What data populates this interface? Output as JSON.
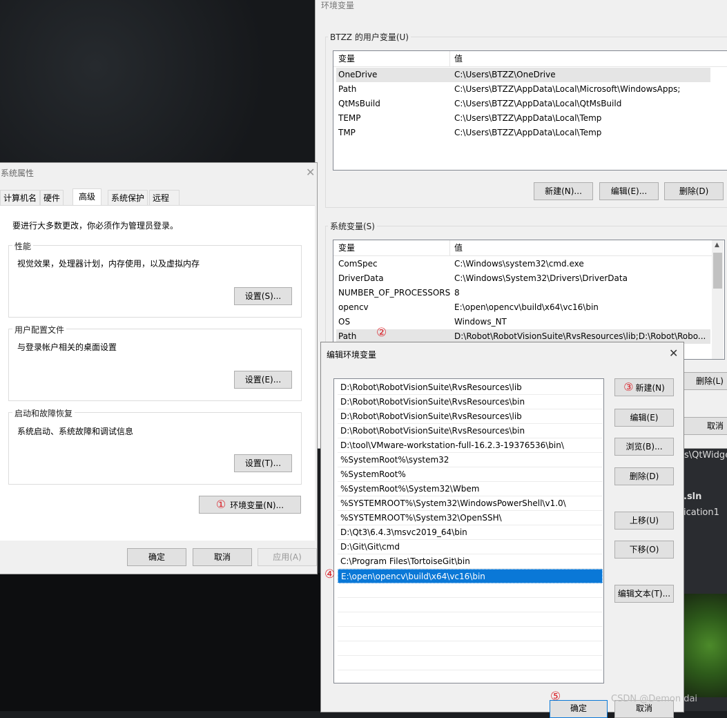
{
  "env_window": {
    "title": "环境变量",
    "user_group_label": "BTZZ 的用户变量(U)",
    "user_header": [
      "变量",
      "值"
    ],
    "user_rows": [
      {
        "name": "OneDrive",
        "value": "C:\\Users\\BTZZ\\OneDrive"
      },
      {
        "name": "Path",
        "value": "C:\\Users\\BTZZ\\AppData\\Local\\Microsoft\\WindowsApps;"
      },
      {
        "name": "QtMsBuild",
        "value": "C:\\Users\\BTZZ\\AppData\\Local\\QtMsBuild"
      },
      {
        "name": "TEMP",
        "value": "C:\\Users\\BTZZ\\AppData\\Local\\Temp"
      },
      {
        "name": "TMP",
        "value": "C:\\Users\\BTZZ\\AppData\\Local\\Temp"
      }
    ],
    "user_buttons": {
      "new": "新建(N)...",
      "edit": "编辑(E)...",
      "delete": "删除(D)"
    },
    "sys_group_label": "系统变量(S)",
    "sys_header": [
      "变量",
      "值"
    ],
    "sys_rows": [
      {
        "name": "ComSpec",
        "value": "C:\\Windows\\system32\\cmd.exe"
      },
      {
        "name": "DriverData",
        "value": "C:\\Windows\\System32\\Drivers\\DriverData"
      },
      {
        "name": "NUMBER_OF_PROCESSORS",
        "value": "8"
      },
      {
        "name": "opencv",
        "value": "E:\\open\\opencv\\build\\x64\\vc16\\bin"
      },
      {
        "name": "OS",
        "value": "Windows_NT"
      },
      {
        "name": "Path",
        "value": "D:\\Robot\\RobotVisionSuite\\RvsResources\\lib;D:\\Robot\\Robo..."
      }
    ],
    "sys_delete_partial": "删除(L)",
    "cancel_partial": "取消"
  },
  "sys_props": {
    "title": "系统属性",
    "tabs": [
      "计算机名",
      "硬件",
      "高级",
      "系统保护",
      "远程"
    ],
    "admin_note": "要进行大多数更改，你必须作为管理员登录。",
    "perf_label": "性能",
    "perf_desc": "视觉效果，处理器计划，内存使用，以及虚拟内存",
    "perf_btn": "设置(S)...",
    "profile_label": "用户配置文件",
    "profile_desc": "与登录帐户相关的桌面设置",
    "profile_btn": "设置(E)...",
    "startup_label": "启动和故障恢复",
    "startup_desc": "系统启动、系统故障和调试信息",
    "startup_btn": "设置(T)...",
    "env_btn": "环境变量(N)...",
    "ok": "确定",
    "cancel": "取消",
    "apply": "应用(A)"
  },
  "edit_dialog": {
    "title": "编辑环境变量",
    "entries": [
      "D:\\Robot\\RobotVisionSuite\\RvsResources\\lib",
      "D:\\Robot\\RobotVisionSuite\\RvsResources\\bin",
      "D:\\Robot\\RobotVisionSuite\\RvsResources\\lib",
      "D:\\Robot\\RobotVisionSuite\\RvsResources\\bin",
      "D:\\tool\\VMware-workstation-full-16.2.3-19376536\\bin\\",
      "%SystemRoot%\\system32",
      "%SystemRoot%",
      "%SystemRoot%\\System32\\Wbem",
      "%SYSTEMROOT%\\System32\\WindowsPowerShell\\v1.0\\",
      "%SYSTEMROOT%\\System32\\OpenSSH\\",
      "D:\\Qt3\\6.4.3\\msvc2019_64\\bin",
      "D:\\Git\\Git\\cmd",
      "C:\\Program Files\\TortoiseGit\\bin",
      "E:\\open\\opencv\\build\\x64\\vc16\\bin"
    ],
    "selected_index": 13,
    "buttons": {
      "new": "新建(N)",
      "edit": "编辑(E)",
      "browse": "浏览(B)...",
      "delete": "删除(D)",
      "up": "上移(U)",
      "down": "下移(O)",
      "edit_text": "编辑文本(T)..."
    },
    "ok_partial": "确定",
    "cancel_partial": "取消"
  },
  "annotations": [
    "①",
    "②",
    "③",
    "④",
    "⑤"
  ],
  "background": {
    "qt_path_fragment": "os\\QtWidge",
    "sln_fragment": ".sln",
    "app_fragment": "ication1",
    "watermark": "CSDN @Demon dai"
  },
  "colors": {
    "selection": "#0a78d7",
    "annotation": "#d9232a"
  }
}
